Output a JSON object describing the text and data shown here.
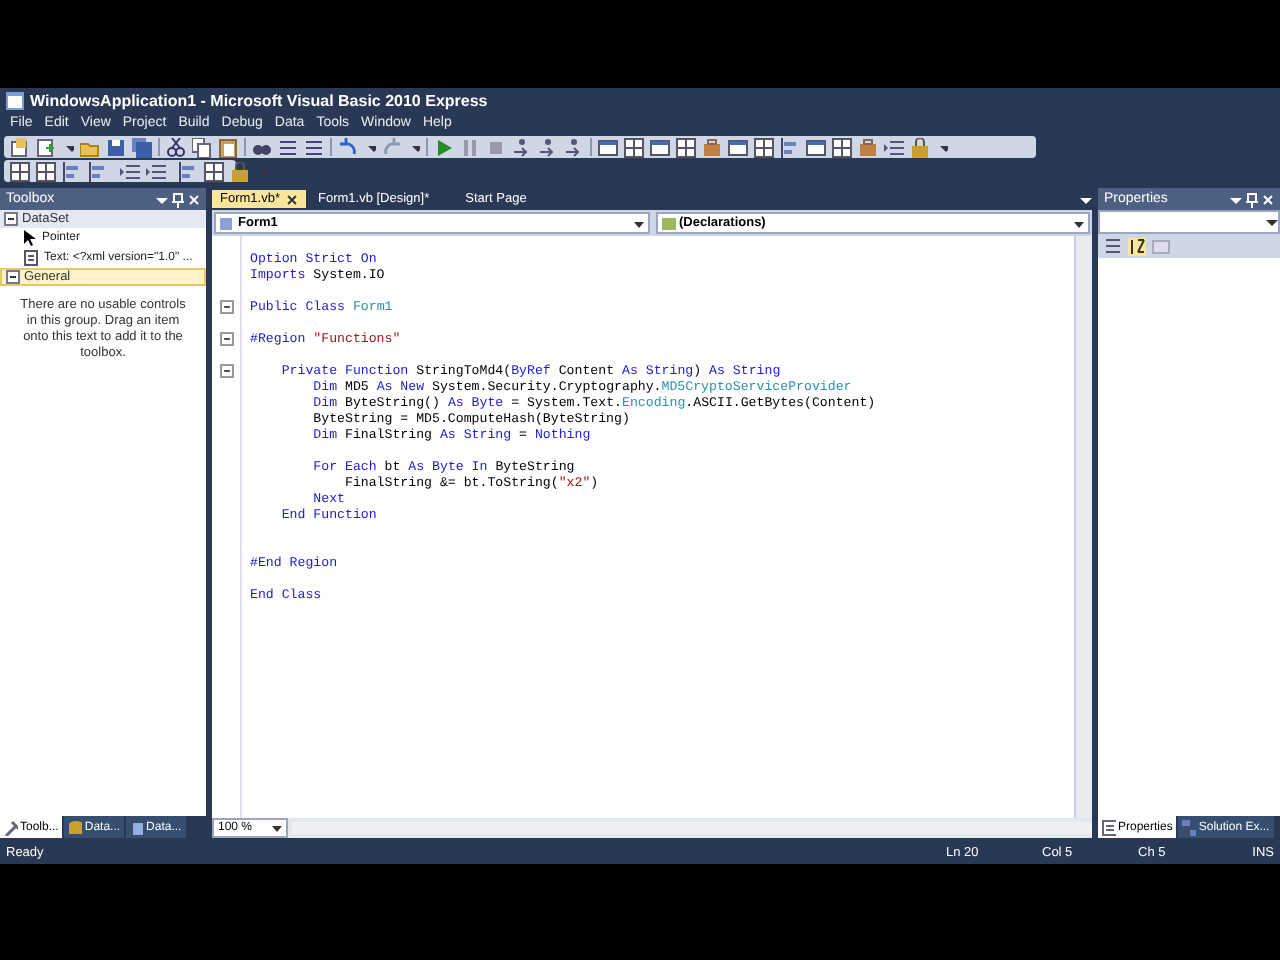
{
  "window": {
    "title": "WindowsApplication1 - Microsoft Visual Basic 2010 Express"
  },
  "menu": [
    "File",
    "Edit",
    "View",
    "Project",
    "Build",
    "Debug",
    "Data",
    "Tools",
    "Window",
    "Help"
  ],
  "toolbox": {
    "title": "Toolbox",
    "groups": [
      {
        "label": "DataSet",
        "expanded": true,
        "selected": false,
        "items": [
          {
            "label": "Pointer",
            "kind": "pointer"
          },
          {
            "label": "Text: <?xml version=\"1.0\" ...",
            "kind": "text"
          }
        ]
      },
      {
        "label": "General",
        "expanded": true,
        "selected": true,
        "message": "There are no usable controls in this group. Drag an item onto this text to add it to the toolbox."
      }
    ],
    "tabs": [
      {
        "label": "Toolb...",
        "selected": true,
        "kind": "toolbox"
      },
      {
        "label": "Data...",
        "selected": false,
        "kind": "datasource"
      },
      {
        "label": "Data...",
        "selected": false,
        "kind": "database"
      }
    ]
  },
  "editor": {
    "tabs": [
      {
        "label": "Form1.vb*",
        "selected": true,
        "closable": true
      },
      {
        "label": "Form1.vb [Design]*",
        "selected": false
      },
      {
        "label": "Start Page",
        "selected": false
      }
    ],
    "class_dropdown": "Form1",
    "member_dropdown": "(Declarations)",
    "zoom": "100 %",
    "lines": [
      {
        "kind": "code",
        "segments": [
          {
            "text": "Option Strict On",
            "kind": "keyword"
          }
        ]
      },
      {
        "kind": "code",
        "segments": [
          {
            "text": "Imports ",
            "kind": "keyword"
          },
          {
            "text": "System.IO",
            "kind": "plain"
          }
        ]
      },
      {
        "kind": "blank"
      },
      {
        "kind": "code",
        "foldable": true,
        "segments": [
          {
            "text": "Public Class ",
            "kind": "keyword"
          },
          {
            "text": "Form1",
            "kind": "type"
          }
        ]
      },
      {
        "kind": "blank"
      },
      {
        "kind": "code",
        "foldable": true,
        "segments": [
          {
            "text": "#Region ",
            "kind": "keyword"
          },
          {
            "text": "\"Functions\"",
            "kind": "string"
          }
        ]
      },
      {
        "kind": "blank"
      },
      {
        "kind": "code",
        "foldable": true,
        "segments": [
          {
            "text": "    Private Function ",
            "kind": "keyword"
          },
          {
            "text": "StringToMd4(",
            "kind": "plain"
          },
          {
            "text": "ByRef ",
            "kind": "keyword"
          },
          {
            "text": "Content ",
            "kind": "plain"
          },
          {
            "text": "As String",
            "kind": "keyword"
          },
          {
            "text": ") ",
            "kind": "plain"
          },
          {
            "text": "As String",
            "kind": "keyword"
          }
        ]
      },
      {
        "kind": "code",
        "segments": [
          {
            "text": "        Dim ",
            "kind": "keyword"
          },
          {
            "text": "MD5 ",
            "kind": "plain"
          },
          {
            "text": "As New ",
            "kind": "keyword"
          },
          {
            "text": "System.Security.Cryptography.",
            "kind": "plain"
          },
          {
            "text": "MD5CryptoServiceProvider",
            "kind": "type"
          }
        ]
      },
      {
        "kind": "code",
        "segments": [
          {
            "text": "        Dim ",
            "kind": "keyword"
          },
          {
            "text": "ByteString() ",
            "kind": "plain"
          },
          {
            "text": "As Byte ",
            "kind": "keyword"
          },
          {
            "text": "= System.Text.",
            "kind": "plain"
          },
          {
            "text": "Encoding",
            "kind": "type"
          },
          {
            "text": ".ASCII.GetBytes(Content)",
            "kind": "plain"
          }
        ]
      },
      {
        "kind": "code",
        "segments": [
          {
            "text": "        ByteString = MD5.ComputeHash(ByteString)",
            "kind": "plain"
          }
        ]
      },
      {
        "kind": "code",
        "segments": [
          {
            "text": "        Dim ",
            "kind": "keyword"
          },
          {
            "text": "FinalString ",
            "kind": "plain"
          },
          {
            "text": "As String ",
            "kind": "keyword"
          },
          {
            "text": "= ",
            "kind": "plain"
          },
          {
            "text": "Nothing",
            "kind": "keyword"
          }
        ]
      },
      {
        "kind": "blank"
      },
      {
        "kind": "code",
        "segments": [
          {
            "text": "        For Each ",
            "kind": "keyword"
          },
          {
            "text": "bt ",
            "kind": "plain"
          },
          {
            "text": "As Byte In ",
            "kind": "keyword"
          },
          {
            "text": "ByteString",
            "kind": "plain"
          }
        ]
      },
      {
        "kind": "code",
        "segments": [
          {
            "text": "            FinalString &= bt.ToString(",
            "kind": "plain"
          },
          {
            "text": "\"x2\"",
            "kind": "string"
          },
          {
            "text": ")",
            "kind": "plain"
          }
        ]
      },
      {
        "kind": "code",
        "segments": [
          {
            "text": "        Next",
            "kind": "keyword"
          }
        ]
      },
      {
        "kind": "code",
        "segments": [
          {
            "text": "    End Function",
            "kind": "keyword"
          }
        ]
      },
      {
        "kind": "blank"
      },
      {
        "kind": "blank"
      },
      {
        "kind": "code",
        "segments": [
          {
            "text": "#End Region",
            "kind": "keyword"
          }
        ]
      },
      {
        "kind": "blank"
      },
      {
        "kind": "code",
        "segments": [
          {
            "text": "End Class",
            "kind": "keyword"
          }
        ]
      }
    ]
  },
  "properties": {
    "title": "Properties",
    "tabs": [
      {
        "label": "Properties",
        "selected": true,
        "kind": "properties"
      },
      {
        "label": "Solution Ex...",
        "selected": false,
        "kind": "solution"
      }
    ]
  },
  "status_bar": {
    "message": "Ready",
    "line": "Ln 20",
    "column": "Col 5",
    "char": "Ch 5",
    "mode": "INS"
  }
}
